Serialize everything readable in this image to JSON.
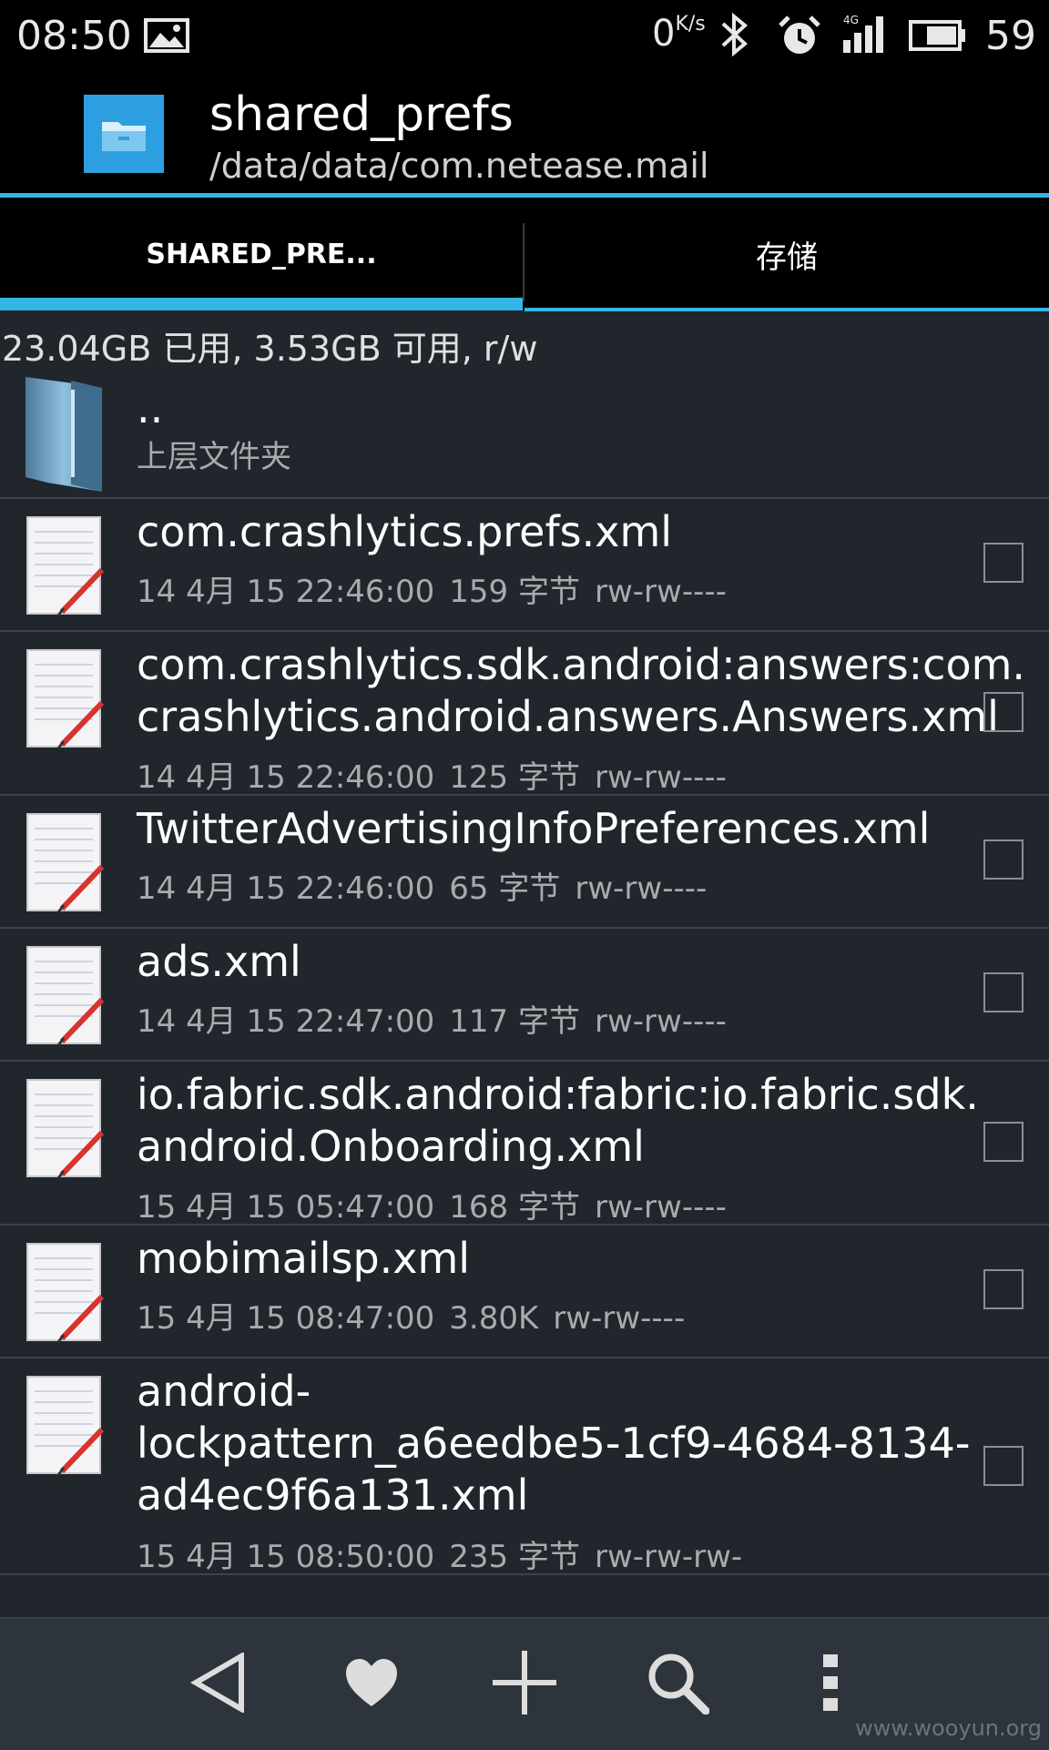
{
  "status_bar": {
    "time": "08:50",
    "net_speed": "0",
    "net_unit": "K/s",
    "network_type": "4G",
    "battery": "59"
  },
  "title_bar": {
    "title": "shared_prefs",
    "path": "/data/data/com.netease.mail"
  },
  "tabs": [
    {
      "label": "SHARED_PRE..."
    },
    {
      "label": "存储"
    }
  ],
  "storage_info": "23.04GB 已用, 3.53GB 可用, r/w",
  "parent": {
    "name": "..",
    "label": "上层文件夹"
  },
  "files": [
    {
      "name": "com.crashlytics.prefs.xml",
      "date": "14 4月 15 22:46:00",
      "size": "159 字节",
      "perms": "rw-rw----"
    },
    {
      "name": "com.crashlytics.sdk.android:answers:com.crashlytics.android.answers.Answers.xml",
      "name_line1": "com.crashlytics.sdk.android:answers:com.",
      "name_line2": "crashlytics.android.answers.Answers.xml",
      "date": "14 4月 15 22:46:00",
      "size": "125 字节",
      "perms": "rw-rw----"
    },
    {
      "name": "TwitterAdvertisingInfoPreferences.xml",
      "date": "14 4月 15 22:46:00",
      "size": "65 字节",
      "perms": "rw-rw----"
    },
    {
      "name": "ads.xml",
      "date": "14 4月 15 22:47:00",
      "size": "117 字节",
      "perms": "rw-rw----"
    },
    {
      "name": "io.fabric.sdk.android:fabric:io.fabric.sdk.android.Onboarding.xml",
      "name_line1": "io.fabric.sdk.android:fabric:io.fabric.sdk.",
      "name_line2": "android.Onboarding.xml",
      "date": "15 4月 15 05:47:00",
      "size": "168 字节",
      "perms": "rw-rw----"
    },
    {
      "name": "mobimailsp.xml",
      "date": "15 4月 15 08:47:00",
      "size": "3.80K",
      "perms": "rw-rw----"
    },
    {
      "name": "android-lockpattern_a6eedbe5-1cf9-4684-8134-ad4ec9f6a131.xml",
      "name_line1": "android-",
      "name_line2": "lockpattern_a6eedbe5-1cf9-4684-8134-",
      "name_line3": "ad4ec9f6a131.xml",
      "date": "15 4月 15 08:50:00",
      "size": "235 字节",
      "perms": "rw-rw-rw-"
    }
  ],
  "bottom_bar": {
    "icons": [
      "back-triangle-icon",
      "heart-icon",
      "plus-icon",
      "search-icon",
      "more-vertical-icon"
    ]
  },
  "watermark": "www.wooyun.org",
  "colors": {
    "accent": "#33b5e5",
    "background": "#20262c",
    "bar": "#000000"
  }
}
